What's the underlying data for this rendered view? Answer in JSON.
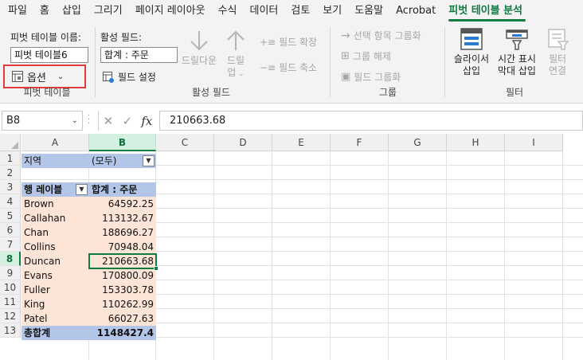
{
  "tabs": [
    "파일",
    "홈",
    "삽입",
    "그리기",
    "페이지 레이아웃",
    "수식",
    "데이터",
    "검토",
    "보기",
    "도움말",
    "Acrobat",
    "피벗 테이블 분석"
  ],
  "ribbon": {
    "pivot_table": {
      "name_label": "피벗 테이블 이름:",
      "name_value": "피벗 테이블6",
      "options_label": "옵션",
      "group_label": "피벗 테이블"
    },
    "active_field": {
      "label": "활성 필드:",
      "value": "합계 : 주문",
      "field_settings": "필드 설정",
      "drill_down": "드릴다운",
      "drill_up_1": "드릴",
      "drill_up_2": "업",
      "expand_field": "필드 확장",
      "collapse_field": "필드 축소",
      "group_label": "활성 필드"
    },
    "group": {
      "group_selection": "선택 항목 그룹화",
      "ungroup": "그룹 해제",
      "group_field": "필드 그룹화",
      "group_label": "그룹"
    },
    "filter": {
      "slicer_1": "슬라이서",
      "slicer_2": "삽입",
      "timeline_1": "시간 표시",
      "timeline_2": "막대 삽입",
      "filter_conn_1": "필터",
      "filter_conn_2": "연결",
      "group_label": "필터"
    }
  },
  "formula_bar": {
    "name_box": "B8",
    "formula": "210663.68"
  },
  "columns": [
    "A",
    "B",
    "C",
    "D",
    "E",
    "F",
    "G",
    "H",
    "I"
  ],
  "rows": [
    "1",
    "2",
    "3",
    "4",
    "5",
    "6",
    "7",
    "8",
    "9",
    "10",
    "11",
    "12",
    "13"
  ],
  "pivot": {
    "filter_label": "지역",
    "filter_value": "(모두)",
    "row_labels_header": "행 레이블",
    "values_header": "합계 : 주문",
    "items": [
      {
        "name": "Brown",
        "value": "64592.25"
      },
      {
        "name": "Callahan",
        "value": "113132.67"
      },
      {
        "name": "Chan",
        "value": "188696.27"
      },
      {
        "name": "Collins",
        "value": "70948.04"
      },
      {
        "name": "Duncan",
        "value": "210663.68"
      },
      {
        "name": "Evans",
        "value": "170800.09"
      },
      {
        "name": "Fuller",
        "value": "153303.78"
      },
      {
        "name": "King",
        "value": "110262.99"
      },
      {
        "name": "Patel",
        "value": "66027.63"
      }
    ],
    "total_label": "총합계",
    "total_value": "1148427.4"
  },
  "colors": {
    "accent": "#107c41",
    "pivot_header": "#b4c6e7",
    "pivot_item": "#fce4d6",
    "highlight": "#e0393e"
  }
}
